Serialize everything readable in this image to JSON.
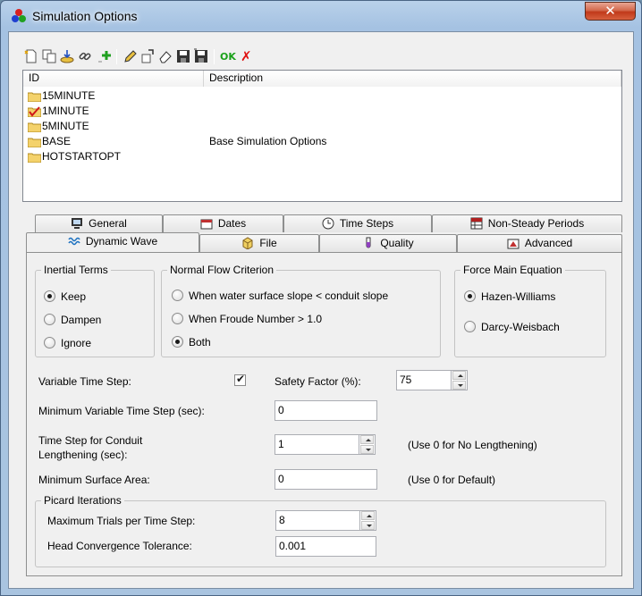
{
  "window": {
    "title": "Simulation Options",
    "close_label": "✕"
  },
  "toolbar": {
    "icons": [
      "new-icon",
      "copy-icon",
      "import-icon",
      "link-icon",
      "add-icon",
      "edit-icon",
      "rename-icon",
      "erase-icon",
      "save-icon",
      "save-all-icon"
    ],
    "ok_label": "OK",
    "cancel_label": "✗"
  },
  "list": {
    "columns": [
      "ID",
      "Description"
    ],
    "rows": [
      {
        "id": "15MINUTE",
        "description": "",
        "checked": false
      },
      {
        "id": "1MINUTE",
        "description": "",
        "checked": true
      },
      {
        "id": "5MINUTE",
        "description": "",
        "checked": false
      },
      {
        "id": "BASE",
        "description": "Base Simulation Options",
        "checked": false
      },
      {
        "id": "HOTSTARTOPT",
        "description": "",
        "checked": false
      }
    ]
  },
  "tabs": {
    "row1": [
      "General",
      "Dates",
      "Time Steps",
      "Non-Steady Periods"
    ],
    "row2": [
      "Dynamic Wave",
      "File",
      "Quality",
      "Advanced"
    ],
    "active": "Dynamic Wave"
  },
  "inertial": {
    "title": "Inertial Terms",
    "options": [
      "Keep",
      "Dampen",
      "Ignore"
    ],
    "selected": "Keep"
  },
  "normal_flow": {
    "title": "Normal Flow Criterion",
    "options": [
      "When water surface slope < conduit slope",
      "When Froude Number > 1.0",
      "Both"
    ],
    "selected": "Both"
  },
  "force_main": {
    "title": "Force Main Equation",
    "options": [
      "Hazen-Williams",
      "Darcy-Weisbach"
    ],
    "selected": "Hazen-Williams"
  },
  "fields": {
    "variable_time_step_label": "Variable Time Step:",
    "variable_time_step_checked": true,
    "safety_factor_label": "Safety Factor (%):",
    "safety_factor_value": "75",
    "min_variable_ts_label": "Minimum Variable Time Step (sec):",
    "min_variable_ts_value": "0",
    "lengthening_label_1": "Time Step for Conduit",
    "lengthening_label_2": "Lengthening (sec):",
    "lengthening_value": "1",
    "lengthening_hint": "(Use 0 for No Lengthening)",
    "min_surface_label": "Minimum Surface Area:",
    "min_surface_value": "0",
    "min_surface_hint": "(Use 0 for Default)"
  },
  "picard": {
    "title": "Picard Iterations",
    "max_trials_label": "Maximum Trials per Time Step:",
    "max_trials_value": "8",
    "head_tol_label": "Head Convergence Tolerance:",
    "head_tol_value": "0.001"
  }
}
